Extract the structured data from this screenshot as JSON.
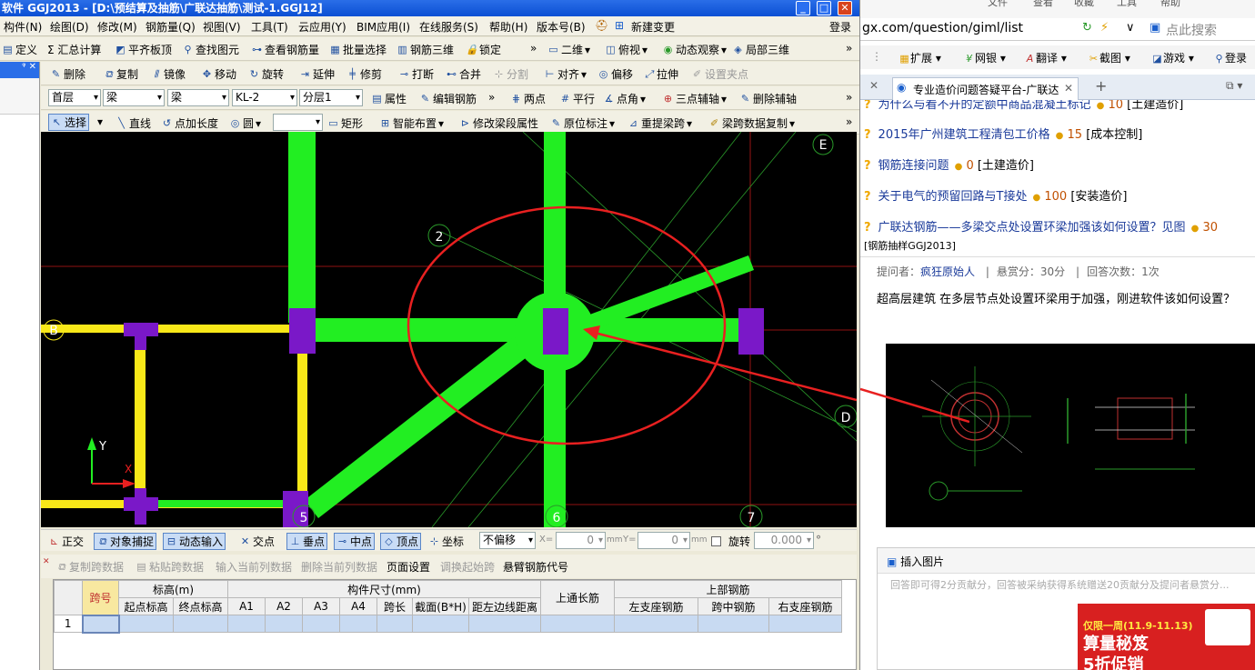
{
  "app": {
    "title": "软件 GGJ2013 - [D:\\预结算及抽筋\\广联达抽筋\\测试-1.GGJ12]",
    "window_buttons": {
      "min": "_",
      "max": "□",
      "close": "✕"
    },
    "menus": [
      "构件(N)",
      "绘图(D)",
      "修改(M)",
      "钢筋量(Q)",
      "视图(V)",
      "工具(T)",
      "云应用(Y)",
      "BIM应用(I)",
      "在线服务(S)",
      "帮助(H)",
      "版本号(B)",
      "新建变更"
    ],
    "login": "登录"
  },
  "toolbar1": [
    "定义",
    "Σ 汇总计算",
    "平齐板顶",
    "查找图元",
    "查看钢筋量",
    "批量选择",
    "钢筋三维",
    "锁定",
    "二维",
    "俯视",
    "动态观察",
    "局部三维"
  ],
  "toolbar2": [
    "删除",
    "复制",
    "镜像",
    "移动",
    "旋转",
    "延伸",
    "修剪",
    "打断",
    "合并",
    "分割",
    "对齐",
    "偏移",
    "拉伸",
    "设置夹点"
  ],
  "toolbar3": {
    "selects": [
      "首层",
      "梁",
      "梁",
      "KL-2",
      "分层1"
    ],
    "buttons": [
      "属性",
      "编辑钢筋",
      "两点",
      "平行",
      "点角",
      "三点辅轴",
      "删除辅轴"
    ]
  },
  "toolbar4": [
    "选择",
    "直线",
    "点加长度",
    "圆",
    "矩形",
    "智能布置",
    "修改梁段属性",
    "原位标注",
    "重提梁跨",
    "梁跨数据复制"
  ],
  "axis_labels": {
    "e": "E",
    "two": "2",
    "b": "B",
    "d": "D",
    "five": "5",
    "six": "6",
    "seven": "7",
    "y": "Y",
    "x": "X"
  },
  "statusbar": {
    "items": [
      "正交",
      "对象捕捉",
      "动态输入",
      "交点",
      "垂点",
      "中点",
      "顶点",
      "坐标"
    ],
    "offset": "不偏移",
    "x_label": "X=",
    "x_value": "0",
    "y_label": "Y=",
    "y_value": "0",
    "unit": "mm",
    "rotate": "旋转",
    "angle": "0.000"
  },
  "grid_toolbar": [
    "复制跨数据",
    "粘贴跨数据",
    "输入当前列数据",
    "删除当前列数据",
    "页面设置",
    "调换起始跨",
    "悬臂钢筋代号"
  ],
  "grid": {
    "h1": [
      "跨号",
      "标高(m)",
      "构件尺寸(mm)",
      "上通长筋",
      "上部钢筋"
    ],
    "h2": [
      "起点标高",
      "终点标高",
      "A1",
      "A2",
      "A3",
      "A4",
      "跨长",
      "截面(B*H)",
      "距左边线距离",
      "左支座钢筋",
      "跨中钢筋",
      "右支座钢筋"
    ],
    "row": "1"
  },
  "browser": {
    "url": "gx.com/question/giml/list",
    "search_placeholder": "点此搜索",
    "top_menu": [
      "文件",
      "查看",
      "收藏",
      "工具",
      "帮助"
    ],
    "toolbar": [
      "扩展",
      "网银",
      "翻译",
      "截图",
      "游戏",
      "登录"
    ],
    "tab": "专业造价问题答疑平台-广联达",
    "questions": [
      {
        "title": "为什么与看不开的定额中商品混凝土标记",
        "coin": "10",
        "tag": "[土建造价]"
      },
      {
        "title": "2015年广州建筑工程清包工价格",
        "coin": "15",
        "tag": "[成本控制]"
      },
      {
        "title": "钢筋连接问题",
        "coin": "0",
        "tag": "[土建造价]"
      },
      {
        "title": "关于电气的预留回路与T接处",
        "coin": "100",
        "tag": "[安装造价]"
      },
      {
        "title": "广联达钢筋——多梁交点处设置环梁加强该如何设置？见图",
        "coin": "30",
        "tag": "[钢筋抽样GGJ2013]"
      }
    ],
    "meta": {
      "asker_label": "提问者：",
      "asker": "疯狂原始人",
      "reward": "悬赏分：30分",
      "answers": "回答次数：1次"
    },
    "body": "超高层建筑 在多层节点处设置环梁用于加强，刚进软件该如何设置？",
    "insert_image": "插入图片",
    "answer_placeholder": "回答即可得2分贡献分，回答被采纳获得系统赠送20贡献分及提问者悬赏分...",
    "ad": {
      "line1": "仅限一周(11.9-11.13)",
      "line2": "算量秘笈",
      "line3": "5折促销"
    }
  },
  "colors": {
    "beam": "#22ee22",
    "column": "#7a18c8",
    "yellow_beam": "#f8e818",
    "annot": "#e82020",
    "canvas": "#000000"
  }
}
